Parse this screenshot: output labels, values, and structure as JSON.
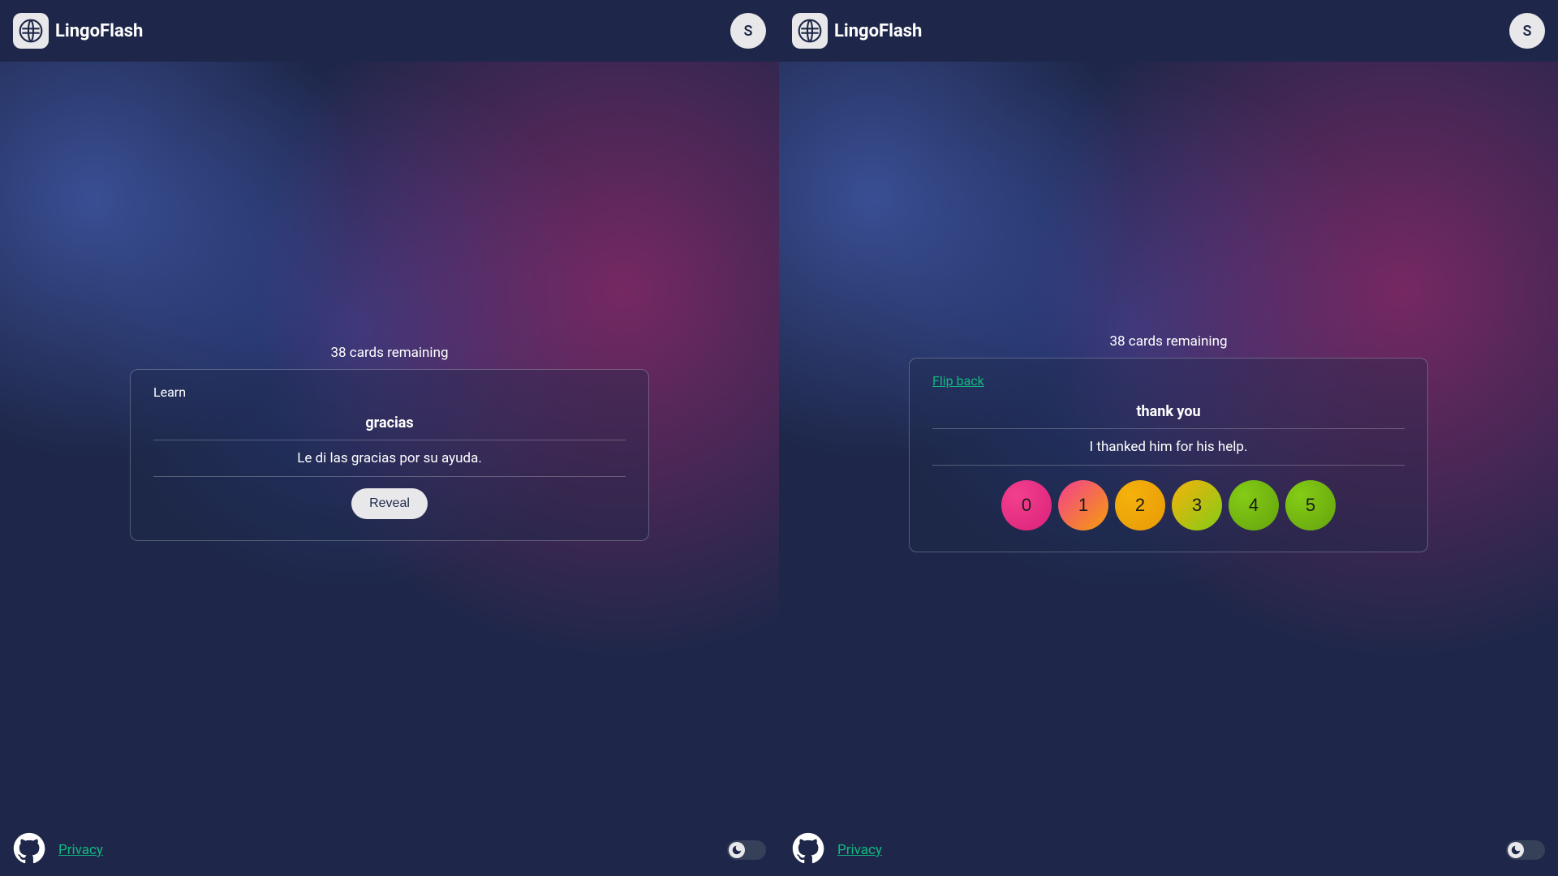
{
  "brand": "LingoFlash",
  "avatar_initial": "S",
  "remaining_text": "38 cards remaining",
  "footer": {
    "privacy": "Privacy"
  },
  "left": {
    "top_label": "Learn",
    "word": "gracias",
    "sentence": "Le di las gracias por su ayuda.",
    "reveal": "Reveal"
  },
  "right": {
    "flip": "Flip back",
    "word": "thank you",
    "sentence": "I thanked him for his help.",
    "ratings": [
      "0",
      "1",
      "2",
      "3",
      "4",
      "5"
    ]
  },
  "colors": {
    "accent": "#10b981",
    "bg": "#1e2749"
  }
}
